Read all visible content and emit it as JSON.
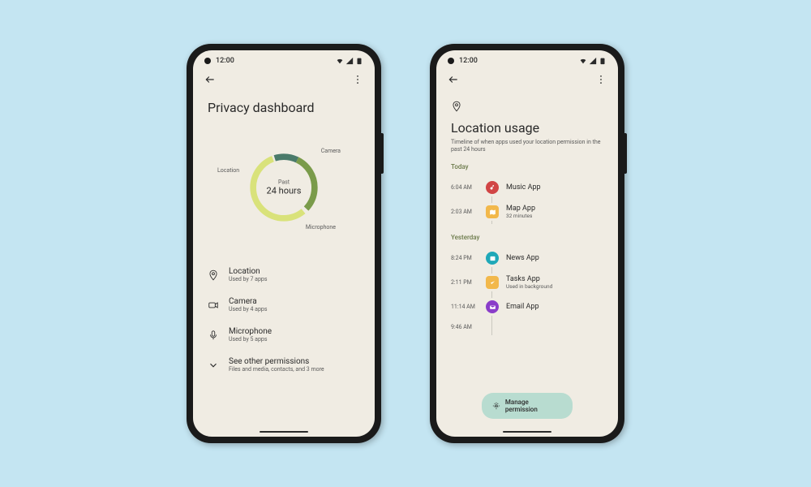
{
  "status": {
    "time": "12:00"
  },
  "phone1": {
    "title": "Privacy dashboard",
    "donut": {
      "past_label": "Past",
      "hours_label": "24 hours",
      "labels": {
        "camera": "Camera",
        "location": "Location",
        "microphone": "Microphone"
      }
    },
    "permissions": [
      {
        "name": "Location",
        "sub": "Used by 7 apps"
      },
      {
        "name": "Camera",
        "sub": "Used by 4 apps"
      },
      {
        "name": "Microphone",
        "sub": "Used by 5 apps"
      },
      {
        "name": "See other permissions",
        "sub": "Files and media, contacts, and 3 more"
      }
    ]
  },
  "phone2": {
    "title": "Location usage",
    "subtitle": "Timeline of when apps used your location permission in the past 24 hours",
    "sections": {
      "today": "Today",
      "yesterday": "Yesterday"
    },
    "today_items": [
      {
        "time": "6:04 AM",
        "name": "Music App",
        "sub": ""
      },
      {
        "time": "2:03 AM",
        "name": "Map App",
        "sub": "32 minutes"
      }
    ],
    "yesterday_items": [
      {
        "time": "8:24 PM",
        "name": "News App",
        "sub": ""
      },
      {
        "time": "2:11 PM",
        "name": "Tasks App",
        "sub": "Used in background"
      },
      {
        "time": "11:14 AM",
        "name": "Email App",
        "sub": ""
      },
      {
        "time": "9:46 AM",
        "name": "",
        "sub": ""
      }
    ],
    "manage_btn": "Manage permission"
  },
  "colors": {
    "accent_teal": "#b8dcd0",
    "donut_camera": "#7a9b4a",
    "donut_location": "#4a7a6a",
    "donut_microphone": "#d9e27a"
  }
}
